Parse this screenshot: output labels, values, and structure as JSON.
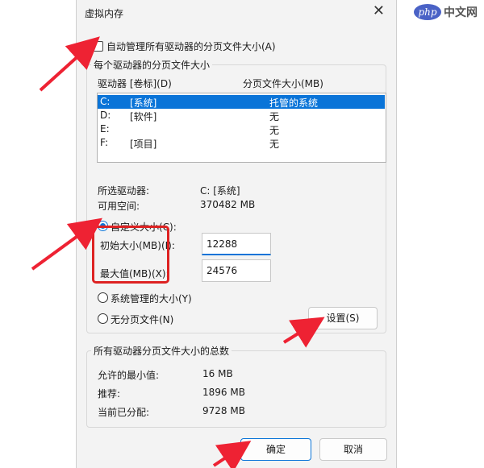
{
  "dialog": {
    "title": "虚拟内存",
    "close_icon": "close-icon"
  },
  "auto_manage": {
    "label": "自动管理所有驱动器的分页文件大小(A)",
    "checked": false
  },
  "per_drive": {
    "group_title": "每个驱动器的分页文件大小",
    "col_drive": "驱动器 [卷标](D)",
    "col_size": "分页文件大小(MB)",
    "rows": [
      {
        "drive": "C:",
        "label": "[系统]",
        "size": "托管的系统",
        "selected": true
      },
      {
        "drive": "D:",
        "label": "[软件]",
        "size": "无",
        "selected": false
      },
      {
        "drive": "E:",
        "label": "",
        "size": "无",
        "selected": false
      },
      {
        "drive": "F:",
        "label": "[项目]",
        "size": "无",
        "selected": false
      }
    ],
    "selected_drive_label": "所选驱动器:",
    "selected_drive_value": "C:  [系统]",
    "free_space_label": "可用空间:",
    "free_space_value": "370482 MB",
    "custom_size_label": "自定义大小(C):",
    "initial_label": "初始大小(MB)(I):",
    "initial_value": "12288",
    "max_label": "最大值(MB)(X):",
    "max_value": "24576",
    "system_managed_label": "系统管理的大小(Y)",
    "no_paging_label": "无分页文件(N)",
    "set_button": "设置(S)"
  },
  "totals": {
    "group_title": "所有驱动器分页文件大小的总数",
    "min_label": "允许的最小值:",
    "min_value": "16 MB",
    "recommended_label": "推荐:",
    "recommended_value": "1896 MB",
    "allocated_label": "当前已分配:",
    "allocated_value": "9728 MB"
  },
  "buttons": {
    "ok": "确定",
    "cancel": "取消"
  },
  "watermark": {
    "text": "php中文网"
  },
  "colors": {
    "accent": "#0a74d8",
    "highlight": "#dd2222"
  }
}
